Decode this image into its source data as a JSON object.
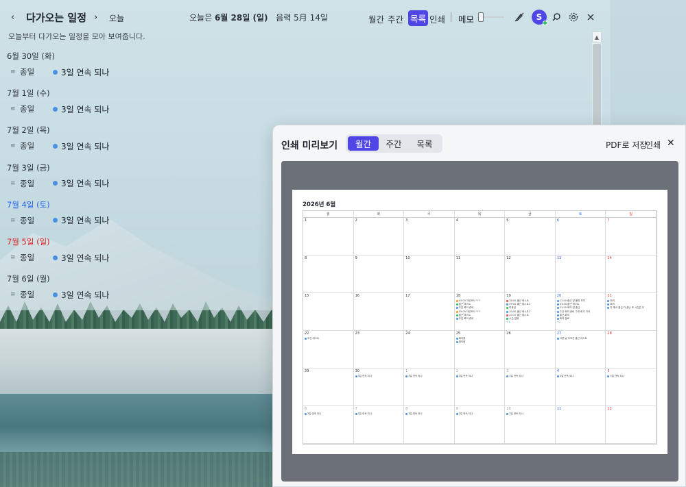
{
  "header": {
    "prev": "‹",
    "title": "다가오는 일정",
    "next": "›",
    "today": "오늘",
    "date_prefix": "오늘은",
    "date_main": "6월 28일 (일)",
    "lunar": "음력 5月 14일",
    "views": [
      "월간",
      "주간",
      "목록",
      "인쇄"
    ],
    "active_view": "목록",
    "memo": "메모",
    "avatar_letter": "S"
  },
  "subtitle": "오늘부터 다가오는 일정을 모아 보여줍니다.",
  "days": [
    {
      "date": "6월 30일 (화)",
      "type": "normal",
      "allday": "종일",
      "event": "3일 연속 되나"
    },
    {
      "date": "7월 1일 (수)",
      "type": "normal",
      "allday": "종일",
      "event": "3일 연속 되나"
    },
    {
      "date": "7월 2일 (목)",
      "type": "normal",
      "allday": "종일",
      "event": "3일 연속 되나"
    },
    {
      "date": "7월 3일 (금)",
      "type": "normal",
      "allday": "종일",
      "event": "3일 연속 되나"
    },
    {
      "date": "7월 4일 (토)",
      "type": "sat",
      "allday": "종일",
      "event": "3일 연속 되나"
    },
    {
      "date": "7월 5일 (일)",
      "type": "sun",
      "allday": "종일",
      "event": "3일 연속 되나"
    },
    {
      "date": "7월 6일 (월)",
      "type": "normal",
      "allday": "종일",
      "event": "3일 연속 되나"
    }
  ],
  "modal": {
    "title": "인쇄 미리보기",
    "tabs": [
      "월간",
      "주간",
      "목록"
    ],
    "active_tab": "월간",
    "pdf": "PDF로 저장",
    "print": "인쇄",
    "close": "✕",
    "calendar_title": "2026년 6월",
    "weekdays": [
      "월",
      "화",
      "수",
      "목",
      "금",
      "토",
      "일"
    ],
    "weeks": [
      [
        {
          "d": "1"
        },
        {
          "d": "2"
        },
        {
          "d": "3"
        },
        {
          "d": "4"
        },
        {
          "d": "5"
        },
        {
          "d": "6"
        },
        {
          "d": "7"
        }
      ],
      [
        {
          "d": "8"
        },
        {
          "d": "9"
        },
        {
          "d": "10"
        },
        {
          "d": "11"
        },
        {
          "d": "12"
        },
        {
          "d": "13"
        },
        {
          "d": "14"
        }
      ],
      [
        {
          "d": "15"
        },
        {
          "d": "16"
        },
        {
          "d": "17"
        },
        {
          "d": "18",
          "ev": [
            "03:00 자료조사 ㅋㅋ",
            "출근 테스트",
            "주간 회의 준비",
            "03:00 자료조사 ㅋㅋ",
            "출근 테스트",
            "주간 회의 준비"
          ],
          "colors": [
            "#f59e0b",
            "#22c55e",
            "#4a90e2",
            "#f59e0b",
            "#22c55e",
            "#4a90e2"
          ]
        },
        {
          "d": "19",
          "ev": [
            "18:00 출근 테스트",
            "09:00 출근 테스트2",
            "미용실",
            "10:00 출근 테스트2",
            "10:10 출근 테스트",
            "시간 없음"
          ],
          "colors": [
            "#ef4444",
            "#4a90e2",
            "#22c55e",
            "#4a90e2",
            "#ef4444",
            "#22c55e"
          ],
          "more": "+1"
        },
        {
          "d": "20",
          "ev": [
            "12:00 출근 앞 풀만 보자",
            "03:00 출근 테스트",
            "21:00 회의 앞 출근",
            "주간 회의 준비 가게 회사 가자",
            "출근 회의",
            "회의 종료"
          ],
          "colors": [
            "#4a90e2",
            "#4a90e2",
            "#4a90e2",
            "#4a90e2",
            "#4a90e2",
            "#4a90e2"
          ],
          "more": "+2"
        },
        {
          "d": "21",
          "ev": [
            "회의",
            "회의",
            "다 해서 출근 다 끝난 후 시간은 다"
          ],
          "colors": [
            "#4a90e2",
            "#4a90e2",
            "#4a90e2"
          ]
        }
      ],
      [
        {
          "d": "22",
          "ev": [
            "주간 테스트"
          ],
          "colors": [
            "#4a90e2"
          ]
        },
        {
          "d": "23"
        },
        {
          "d": "24"
        },
        {
          "d": "25",
          "ev": [
            "회의중",
            "회의중"
          ],
          "colors": [
            "#4a90e2",
            "#4a90e2"
          ]
        },
        {
          "d": "26"
        },
        {
          "d": "27",
          "ev": [
            "다른 날 무조건 출근 테스트"
          ],
          "colors": [
            "#4a90e2"
          ]
        },
        {
          "d": "28"
        }
      ],
      [
        {
          "d": "29"
        },
        {
          "d": "30",
          "ev": [
            "3일 연속 되나"
          ],
          "colors": [
            "#4a90e2"
          ]
        },
        {
          "d": "1",
          "muted": true,
          "ev": [
            "3일 연속 되나"
          ],
          "colors": [
            "#4a90e2"
          ]
        },
        {
          "d": "2",
          "muted": true,
          "ev": [
            "3일 연속 되나"
          ],
          "colors": [
            "#4a90e2"
          ]
        },
        {
          "d": "3",
          "muted": true,
          "ev": [
            "3일 연속 되나"
          ],
          "colors": [
            "#4a90e2"
          ]
        },
        {
          "d": "4",
          "muted": true,
          "ev": [
            "3일 연속 되나"
          ],
          "colors": [
            "#4a90e2"
          ]
        },
        {
          "d": "5",
          "muted": true,
          "ev": [
            "3일 연속 되나"
          ],
          "colors": [
            "#4a90e2"
          ]
        }
      ],
      [
        {
          "d": "6",
          "muted": true,
          "ev": [
            "3일 연속 되나"
          ],
          "colors": [
            "#4a90e2"
          ]
        },
        {
          "d": "7",
          "muted": true,
          "ev": [
            "3일 연속 되나"
          ],
          "colors": [
            "#4a90e2"
          ]
        },
        {
          "d": "8",
          "muted": true,
          "ev": [
            "3일 연속 되나"
          ],
          "colors": [
            "#4a90e2"
          ]
        },
        {
          "d": "9",
          "muted": true,
          "ev": [
            "3일 연속 되나"
          ],
          "colors": [
            "#4a90e2"
          ]
        },
        {
          "d": "10",
          "muted": true,
          "ev": [
            "3일 연속 되나"
          ],
          "colors": [
            "#4a90e2"
          ]
        },
        {
          "d": "11",
          "muted": true
        },
        {
          "d": "12",
          "muted": true
        }
      ]
    ]
  },
  "colors": {
    "accent": "#4f46e5",
    "event_dot": "#4a90e2",
    "saturday": "#2563eb",
    "sunday": "#dc2626"
  }
}
